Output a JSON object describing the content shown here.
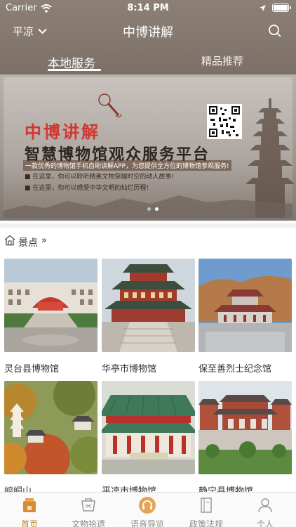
{
  "status_bar": {
    "carrier": "Carrier",
    "time": "8:14 PM"
  },
  "navbar": {
    "city": "平凉",
    "title": "中博讲解"
  },
  "tabs": [
    {
      "label": "本地服务",
      "active": true
    },
    {
      "label": "精品推荐",
      "active": false
    }
  ],
  "banner": {
    "brand": "中博讲解",
    "headline": "智慧博物馆观众服务平台",
    "tagline": "一款优秀的博物馆手机自助讲解APP，为您提供全方位的博物馆参观服务!",
    "line1": "■ 在这里，你可以聆听精美文物穿越时空的动人故事!",
    "line2": "■ 在这里，你可以感受中华文明的灿烂历程!",
    "page_count": 2,
    "active_page": 2
  },
  "scenic": {
    "title": "景点",
    "more": "»",
    "items": [
      {
        "name": "灵台县博物馆"
      },
      {
        "name": "华亭市博物馆"
      },
      {
        "name": "保至善烈士纪念馆"
      },
      {
        "name": "崆峒山"
      },
      {
        "name": "平凉市博物馆"
      },
      {
        "name": "静宁县博物馆"
      }
    ]
  },
  "tabbar": {
    "items": [
      {
        "label": "首页",
        "icon": "home-icon",
        "active": true
      },
      {
        "label": "文物拾遗",
        "icon": "relics-icon",
        "active": false
      },
      {
        "label": "语音导览",
        "icon": "headphones-icon",
        "active": false
      },
      {
        "label": "政策法规",
        "icon": "book-icon",
        "active": false
      },
      {
        "label": "个人",
        "icon": "person-icon",
        "active": false
      }
    ]
  },
  "colors": {
    "header_bg": "#857970",
    "accent": "#c47d2a",
    "inactive": "#8a8a8a"
  }
}
